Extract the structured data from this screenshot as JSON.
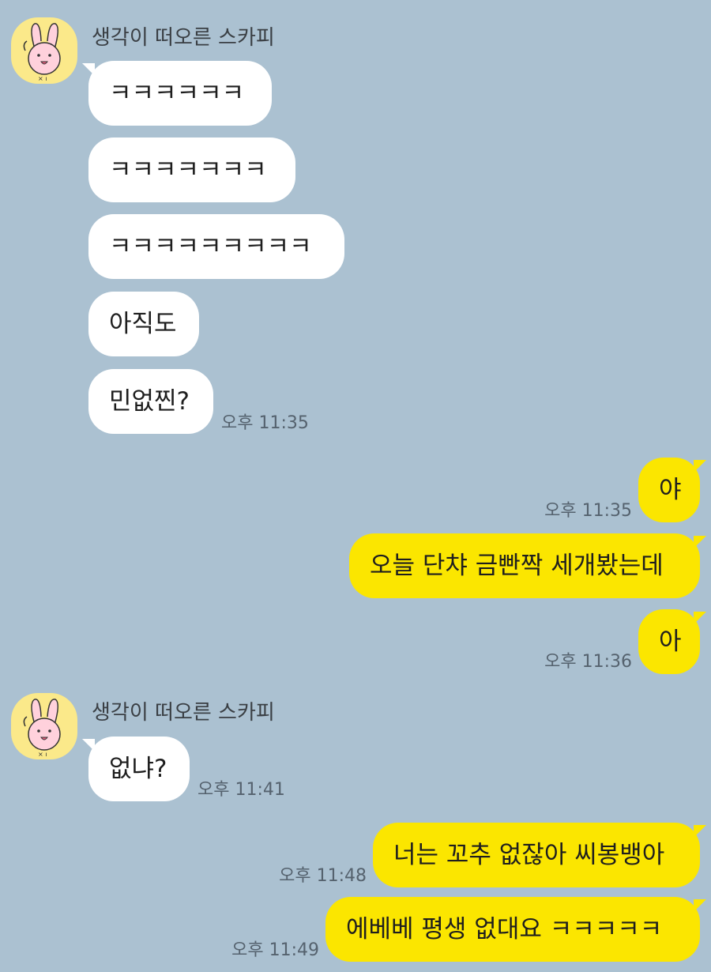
{
  "background_color": "#abc1d1",
  "colors": {
    "incoming_bubble": "#ffffff",
    "outgoing_bubble": "#fbe600",
    "avatar_bg": "#fbe98a"
  },
  "groups": [
    {
      "sender": "생각이 떠오른 스카피",
      "avatar_icon": "pink-bunny-icon",
      "messages": [
        "ㅋㅋㅋㅋㅋㅋ",
        "ㅋㅋㅋㅋㅋㅋㅋ",
        "ㅋㅋㅋㅋㅋㅋㅋㅋㅋ",
        "아직도",
        "민없찐?"
      ],
      "time": "오후 11:35"
    },
    {
      "messages": [
        "야"
      ],
      "time": "오후 11:35"
    },
    {
      "messages": [
        "오늘 단챠 금빤짝 세개봤는데"
      ]
    },
    {
      "messages": [
        "아"
      ],
      "time": "오후 11:36"
    },
    {
      "sender": "생각이 떠오른 스카피",
      "avatar_icon": "pink-bunny-icon",
      "messages": [
        "없냐?"
      ],
      "time": "오후 11:41"
    },
    {
      "messages": [
        "너는 꼬추 없잖아 씨봉뱅아"
      ],
      "time": "오후 11:48"
    },
    {
      "messages": [
        "에베베 평생 없대요 ㅋㅋㅋㅋㅋ"
      ],
      "time": "오후 11:49"
    }
  ]
}
